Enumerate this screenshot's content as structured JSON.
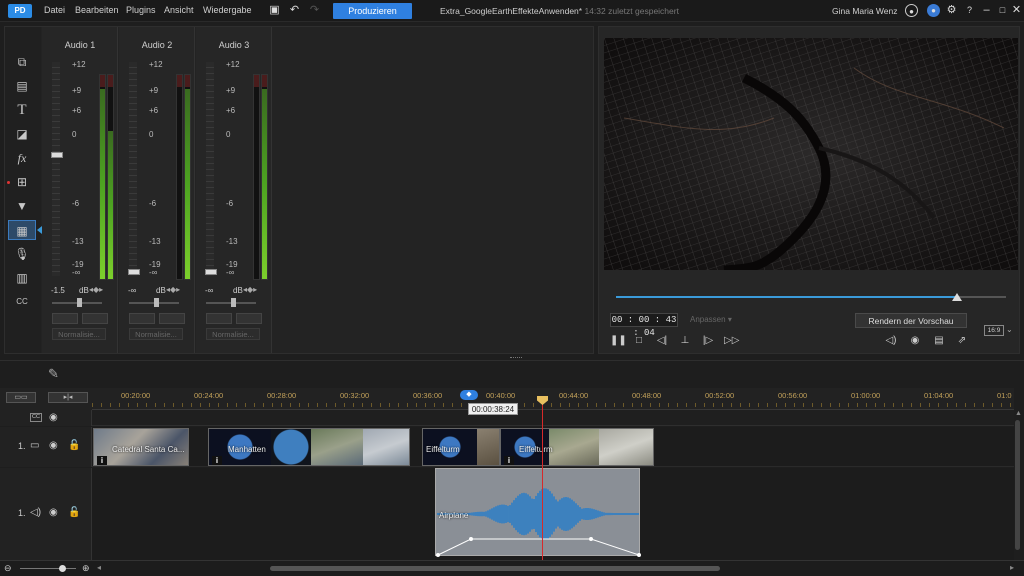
{
  "menubar": {
    "logo": "PD",
    "items": [
      "Datei",
      "Bearbeiten",
      "Plugins",
      "Ansicht",
      "Wiedergabe"
    ],
    "produce_label": "Produzieren",
    "document_name": "Extra_GoogleEarthEffekteAnwenden*",
    "document_saved": "14:32 zuletzt gespeichert",
    "user_name": "Gina Maria Wenz",
    "window_controls": [
      "minimize-icon",
      "maximize-icon",
      "close-icon"
    ]
  },
  "mixer": {
    "channels": [
      {
        "name": "Audio 1",
        "db_value": "-1.5",
        "db_label": "dB",
        "normalize": "Normalisie...",
        "level_left": 0.92,
        "level_right": 0.72
      },
      {
        "name": "Audio 2",
        "db_value": "-∞",
        "db_label": "dB",
        "normalize": "Normalisie...",
        "level_left": 0,
        "level_right": 0.92
      },
      {
        "name": "Audio 3",
        "db_value": "-∞",
        "db_label": "dB",
        "normalize": "Normalisie...",
        "level_left": 0,
        "level_right": 0.92
      }
    ],
    "scale_labels": [
      "+12",
      "+9",
      "+6",
      "0",
      "-6",
      "-13",
      "-19",
      "-∞"
    ]
  },
  "preview": {
    "timecode": "00 : 00 : 43 : 04",
    "timecode_mode": "Anpassen",
    "render_label": "Rendern der Vorschau",
    "aspect_ratio": "16:9",
    "scrub_progress": 0.875
  },
  "timeline": {
    "ruler_ticks": [
      "00:20:00",
      "00:24:00",
      "00:28:00",
      "00:32:00",
      "00:36:00",
      "00:40:00",
      "00:44:00",
      "00:48:00",
      "00:52:00",
      "00:56:00",
      "01:00:00",
      "01:04:00",
      "01:0"
    ],
    "playhead_timecode": "00:00:38:24",
    "video_track_label": "1.",
    "audio_track_label": "1.",
    "video_clips": [
      {
        "label": "Catedral Santa Ca..."
      },
      {
        "label": "Manhatten"
      },
      {
        "label": "Eiffelturm"
      },
      {
        "label": "Eiffelturm"
      }
    ],
    "audio_clip": {
      "label": "Airplane"
    }
  },
  "colors": {
    "accent": "#2f80e0",
    "playhead": "#d62a2a",
    "ruler_text": "#c2a15a",
    "meter_green": "#4da321"
  }
}
